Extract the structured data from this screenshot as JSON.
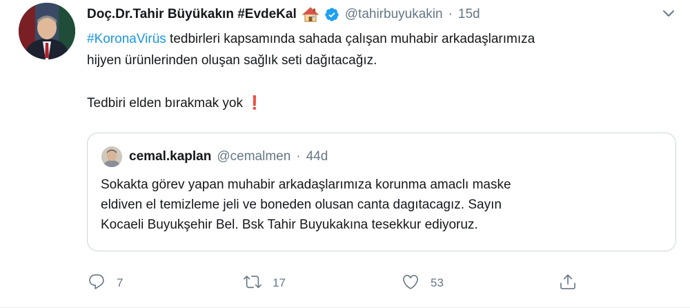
{
  "tweet": {
    "author_name": "Doç.Dr.Tahir Büyükakın #EvdeKal",
    "handle": "@tahirbuyukakin",
    "separator": "·",
    "time": "15d",
    "hashtag": "#KoronaVirüs",
    "line1_rest": " tedbirleri kapsamında sahada çalışan muhabir arkadaşlarımıza",
    "line2": "hijyen ürünlerinden oluşan sağlık seti dağıtacağız.",
    "line3": "Tedbiri elden bırakmak yok",
    "exclamation": "❗"
  },
  "quoted": {
    "author_name": "cemal.kaplan",
    "handle": "@cemalmen",
    "separator": "·",
    "time": "44d",
    "lines": [
      "Sokakta görev yapan muhabir arkadaşlarımıza  korunma amaclı maske",
      "eldiven el temizleme jeli ve boneden olusan canta dagıtacagız. Sayın",
      "Kocaeli Buyukşehir Bel. Bsk Tahir Buyukakına tesekkur ediyoruz."
    ]
  },
  "actions": {
    "reply_count": "7",
    "retweet_count": "17",
    "like_count": "53"
  },
  "colors": {
    "link": "#1b95e0",
    "secondary_text": "#657786",
    "verified": "#1da1f2",
    "border": "#ccd6dd"
  }
}
